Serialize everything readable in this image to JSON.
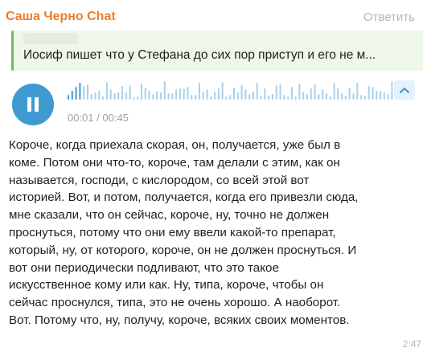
{
  "message": {
    "sender": "Саша Черно Chat",
    "reply_label": "Ответить",
    "quote": {
      "text": "Иосиф пишет что у Стефана до сих пор приступ и его не м..."
    },
    "audio": {
      "time": "00:01 / 00:45",
      "played_fraction": 0.02
    },
    "transcript_lines": [
      "Короче, когда приехала скорая, он, получается, уже был в",
      "коме. Потом они что-то, короче, там делали с этим, как он",
      "называется, господи, с кислородом, со всей этой вот",
      "историей. Вот, и потом, получается, когда его привезли сюда,",
      "мне сказали, что он сейчас, короче, ну, точно не должен",
      "проснуться, потому что они ему ввели какой-то препарат,",
      "который, ну, от которого, короче, он не должен проснуться. И",
      "вот они периодически подливают, что это такое",
      "искусственное кому или как. Ну, типа, короче, чтобы он",
      "сейчас проснулся, типа, это не очень хорошо. А наоборот.",
      "Вот. Потому что, ну, получу, короче, всяких своих моментов."
    ],
    "timestamp": "2:47"
  },
  "icons": {
    "play": "pause-icon",
    "expand": "chevron-up-icon"
  },
  "colors": {
    "sender": "#ea7f2c",
    "quote_bar": "#74b95e",
    "quote_bg": "#eef7e8",
    "play_bg": "#3f9ad2",
    "wave_played": "#3f9ad2",
    "wave_unplayed": "#a9d0ea"
  }
}
